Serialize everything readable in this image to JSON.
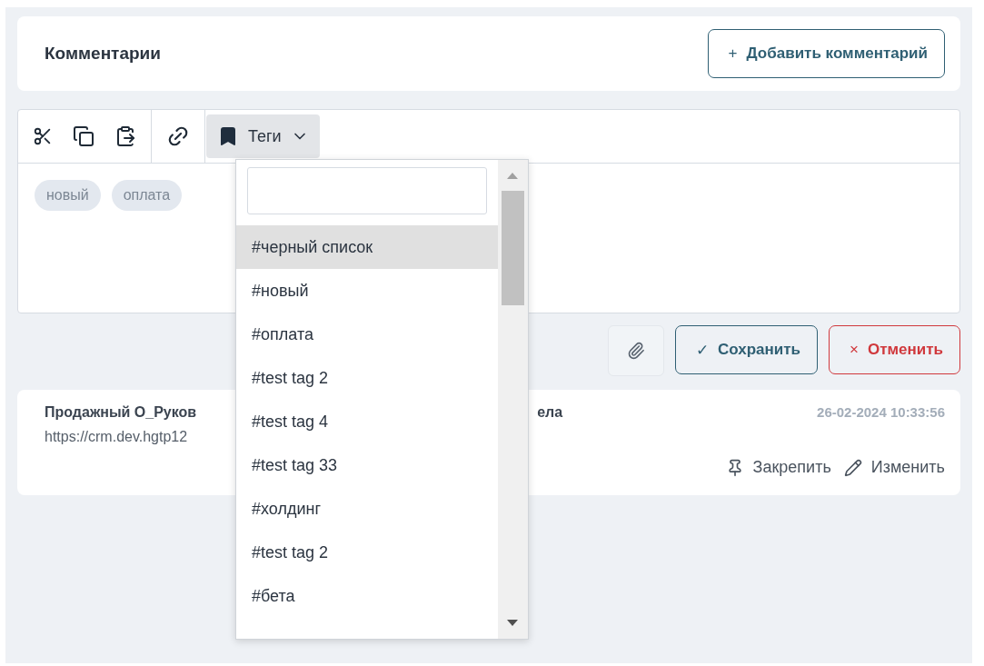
{
  "header": {
    "title": "Комментарии",
    "add_button": {
      "icon": "+",
      "label": "Добавить комментарий"
    }
  },
  "toolbar": {
    "tags_button": {
      "label": "Теги",
      "expanded": true
    }
  },
  "editor": {
    "tags": [
      "новый",
      "оплата"
    ]
  },
  "actions": {
    "save": {
      "icon": "✓",
      "label": "Сохранить"
    },
    "cancel": {
      "icon": "×",
      "label": "Отменить"
    }
  },
  "comment": {
    "title_parts": [
      "Продажный О_Руков",
      "ела"
    ],
    "text": "https://crm.dev.hgtp12",
    "date": "26-02-2024 10:33:56",
    "pin": "Закрепить",
    "edit": "Изменить"
  },
  "dropdown": {
    "items": [
      {
        "label": "#черный список",
        "selected": true
      },
      {
        "label": "#новый",
        "selected": false
      },
      {
        "label": "#оплата",
        "selected": false
      },
      {
        "label": "#test tag 2",
        "selected": false
      },
      {
        "label": "#test tag 4",
        "selected": false
      },
      {
        "label": "#test tag 33",
        "selected": false
      },
      {
        "label": "#холдинг",
        "selected": false
      },
      {
        "label": "#test tag 2",
        "selected": false
      },
      {
        "label": "#бета",
        "selected": false
      }
    ]
  }
}
